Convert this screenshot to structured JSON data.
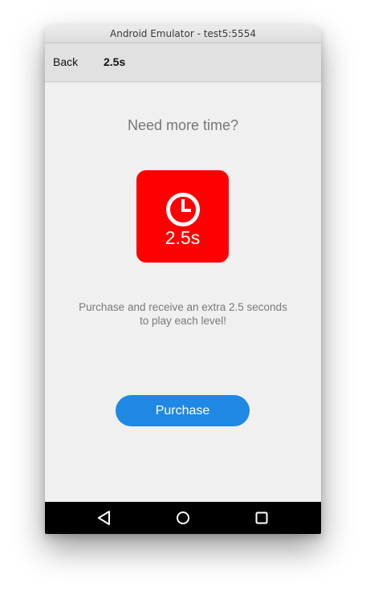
{
  "window": {
    "title": "Android Emulator - test5:5554"
  },
  "appbar": {
    "back_label": "Back",
    "title": "2.5s"
  },
  "main": {
    "heading": "Need more time?",
    "badge": {
      "icon": "clock-icon",
      "value": "2.5s",
      "color": "#ff0000"
    },
    "description": "Purchase and receive an extra 2.5 seconds to play each level!",
    "purchase_label": "Purchase",
    "accent_color": "#1f88e5"
  },
  "navbar": {
    "icons": [
      "back-triangle-icon",
      "home-circle-icon",
      "recents-square-icon"
    ]
  }
}
